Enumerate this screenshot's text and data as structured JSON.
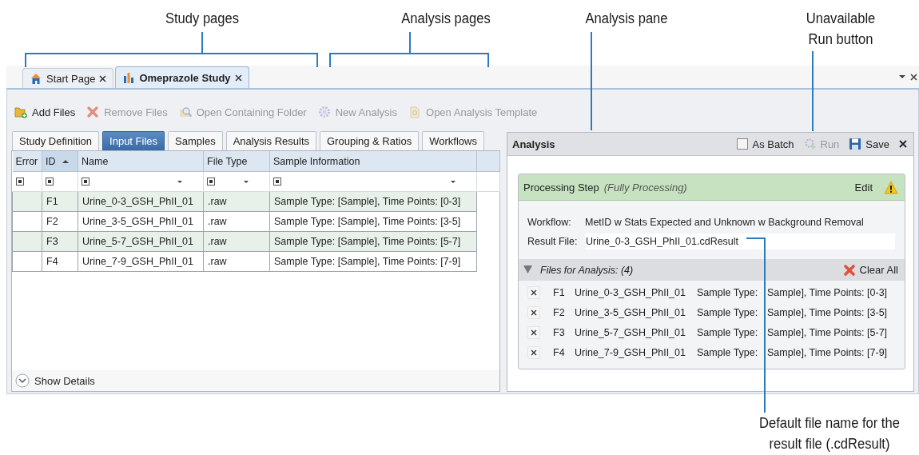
{
  "callouts": [
    {
      "kind": "bracket",
      "text": "Study pages"
    },
    {
      "kind": "bracket",
      "text": "Analysis pages"
    },
    {
      "kind": "line",
      "text": "Analysis pane"
    },
    {
      "kind": "line",
      "text": "Unavailable\nRun button"
    },
    {
      "kind": "line",
      "text": "Default file name for the\nresult file (.cdResult)"
    }
  ],
  "document_tabs": [
    {
      "label": "Start Page",
      "kind": "home",
      "selected": false
    },
    {
      "label": "Omeprazole Study",
      "kind": "study",
      "selected": true
    }
  ],
  "toolbar": [
    {
      "label": "Add Files",
      "kind": "add",
      "disabled": false
    },
    {
      "label": "Remove Files",
      "kind": "remove",
      "disabled": true
    },
    {
      "label": "Open Containing Folder",
      "kind": "folder",
      "disabled": true
    },
    {
      "label": "New Analysis",
      "kind": "gear",
      "disabled": true
    },
    {
      "label": "Open Analysis Template",
      "kind": "template",
      "disabled": true
    }
  ],
  "study_tabs": [
    {
      "label": "Study Definition",
      "selected": false
    },
    {
      "label": "Input Files",
      "selected": true
    },
    {
      "label": "Samples",
      "selected": false
    },
    {
      "label": "Analysis Results",
      "selected": false
    },
    {
      "label": "Grouping & Ratios",
      "selected": false
    },
    {
      "label": "Workflows",
      "selected": false
    }
  ],
  "table": {
    "columns": [
      {
        "label": "Error",
        "sorted": false,
        "dropdown": false
      },
      {
        "label": "ID",
        "sorted": true,
        "dropdown": false
      },
      {
        "label": "Name",
        "sorted": false,
        "dropdown": true
      },
      {
        "label": "File Type",
        "sorted": false,
        "dropdown": true
      },
      {
        "label": "Sample Information",
        "sorted": false,
        "dropdown": true
      }
    ],
    "rows": [
      {
        "id": "F1",
        "name": "Urine_0-3_GSH_PhII_01",
        "file_type": ".raw",
        "sample_information": "Sample Type: [Sample], Time Points: [0-3]"
      },
      {
        "id": "F2",
        "name": "Urine_3-5_GSH_PhII_01",
        "file_type": ".raw",
        "sample_information": "Sample Type: [Sample], Time Points: [3-5]"
      },
      {
        "id": "F3",
        "name": "Urine_5-7_GSH_PhII_01",
        "file_type": ".raw",
        "sample_information": "Sample Type: [Sample], Time Points: [5-7]"
      },
      {
        "id": "F4",
        "name": "Urine_7-9_GSH_PhII_01",
        "file_type": ".raw",
        "sample_information": "Sample Type: [Sample], Time Points: [7-9]"
      }
    ]
  },
  "show_details": {
    "label": "Show Details",
    "expanded": false
  },
  "analysis": {
    "title": "Analysis",
    "as_batch": {
      "label": "As Batch",
      "checked": false
    },
    "run": {
      "label": "Run",
      "disabled": true
    },
    "save": {
      "label": "Save",
      "disabled": false
    },
    "step": {
      "title": "Processing Step",
      "status": "(Fully Processing)",
      "edit": "Edit",
      "warning": true,
      "workflow_label": "Workflow:",
      "workflow": "MetID w Stats Expected and Unknown w Background Removal",
      "result_label": "Result File:",
      "result_file": "Urine_0-3_GSH_PhII_01.cdResult"
    },
    "files": {
      "title": "Files for Analysis: (4)",
      "expanded": true,
      "clear_all": "Clear All",
      "rows": [
        {
          "id": "F1",
          "name": "Urine_0-3_GSH_PhII_01",
          "sample_type": "Sample Type:",
          "sample_information": "Sample], Time Points: [0-3]"
        },
        {
          "id": "F2",
          "name": "Urine_3-5_GSH_PhII_01",
          "sample_type": "Sample Type:",
          "sample_information": "Sample], Time Points: [3-5]"
        },
        {
          "id": "F3",
          "name": "Urine_5-7_GSH_PhII_01",
          "sample_type": "Sample Type:",
          "sample_information": "Sample], Time Points: [5-7]"
        },
        {
          "id": "F4",
          "name": "Urine_7-9_GSH_PhII_01",
          "sample_type": "Sample Type:",
          "sample_information": "Sample], Time Points: [7-9]"
        }
      ]
    }
  }
}
